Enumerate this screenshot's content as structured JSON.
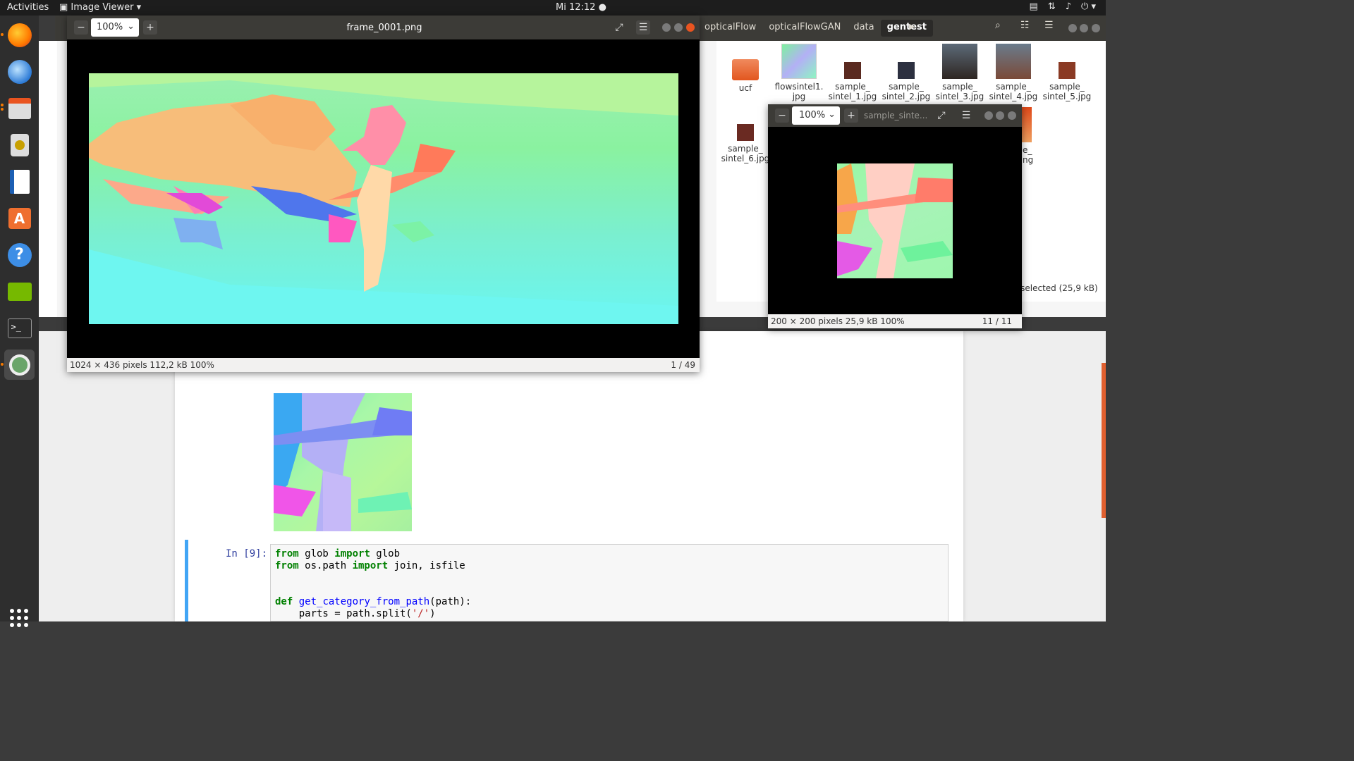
{
  "topbar": {
    "activities": "Activities",
    "app_menu": "Image Viewer",
    "clock": "Mi 12:12"
  },
  "dock": {
    "items": [
      "firefox-icon",
      "thunderbird-icon",
      "files-icon",
      "rhythmbox-icon",
      "writer-icon",
      "software-center-icon",
      "help-icon",
      "nvidia-icon",
      "terminal-icon",
      "image-viewer-icon"
    ]
  },
  "file_manager": {
    "breadcrumbs": [
      "opticalFlow",
      "opticalFlowGAN",
      "data",
      "gentest"
    ],
    "files": [
      {
        "name": "ucf",
        "label1": "ucf",
        "label2": ""
      },
      {
        "name": "flowsintel1",
        "label1": "flowsintel1.",
        "label2": "jpg"
      },
      {
        "name": "sample_sintel_1",
        "label1": "sample_",
        "label2": "sintel_1.jpg"
      },
      {
        "name": "sample_sintel_2",
        "label1": "sample_",
        "label2": "sintel_2.jpg"
      },
      {
        "name": "sample_sintel_3",
        "label1": "sample_",
        "label2": "sintel_3.jpg"
      },
      {
        "name": "sample_sintel_4",
        "label1": "sample_",
        "label2": "sintel_4.jpg"
      },
      {
        "name": "sample_sintel_5",
        "label1": "sample_",
        "label2": "sintel_5.jpg"
      },
      {
        "name": "sample_sintel_6",
        "label1": "sample_",
        "label2": "sintel_6.jpg"
      }
    ],
    "partial_file": {
      "label1": "e_",
      "label2": "ng"
    },
    "status": "' selected  (25,9 kB)"
  },
  "viewer_main": {
    "zoom": "100%",
    "title": "frame_0001.png",
    "status_left": "1024 × 436 pixels  112,2 kB    100%",
    "status_right": "1 / 49"
  },
  "viewer_small": {
    "zoom": "100%",
    "title": "sample_sinte...",
    "status_left": "200 × 200 pixels  25,9 kB    100%",
    "status_right": "11 / 11"
  },
  "notebook": {
    "prompt": "In [9]:",
    "code_lines": [
      {
        "kw1": "from",
        "mid1": " glob ",
        "kw2": "import",
        "rest": " glob"
      },
      {
        "kw1": "from",
        "mid1": " os.path ",
        "kw2": "import",
        "rest": " join, isfile"
      }
    ],
    "def_kw": "def",
    "def_name": "get_category_from_path",
    "def_rest": "(path):",
    "line4_a": "    parts = path.split(",
    "line4_str": "'/'",
    "line4_b": ")"
  }
}
